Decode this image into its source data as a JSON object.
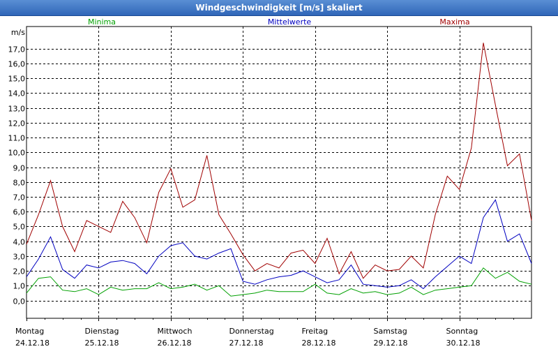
{
  "window": {
    "title": "Windgeschwindigkeit [m/s] skaliert"
  },
  "chart_data": {
    "type": "line",
    "title": "Windgeschwindigkeit [m/s] skaliert",
    "ylabel": "m/s",
    "ylim": [
      -1.2,
      18.5
    ],
    "yticks": [
      "0,0",
      "1,0",
      "2,0",
      "3,0",
      "4,0",
      "5,0",
      "6,0",
      "7,0",
      "8,0",
      "9,0",
      "10,0",
      "11,0",
      "12,0",
      "13,0",
      "14,0",
      "15,0",
      "16,0",
      "17,0"
    ],
    "grid": true,
    "legend_placement": "top",
    "days": [
      {
        "name": "Montag",
        "date": "24.12.18"
      },
      {
        "name": "Dienstag",
        "date": "25.12.18"
      },
      {
        "name": "Mittwoch",
        "date": "26.12.18"
      },
      {
        "name": "Donnerstag",
        "date": "27.12.18"
      },
      {
        "name": "Freitag",
        "date": "28.12.18"
      },
      {
        "name": "Samstag",
        "date": "29.12.18"
      },
      {
        "name": "Sonntag",
        "date": "30.12.18"
      }
    ],
    "x_unit": "hours since 24.12.18 00:00",
    "x": [
      0,
      4,
      8,
      12,
      16,
      20,
      24,
      28,
      32,
      36,
      40,
      44,
      48,
      52,
      56,
      60,
      64,
      68,
      72,
      76,
      80,
      84,
      88,
      92,
      96,
      100,
      104,
      108,
      112,
      116,
      120,
      124,
      128,
      132,
      136,
      140,
      144,
      148,
      152,
      156,
      160,
      164,
      168
    ],
    "series": [
      {
        "name": "Minima",
        "color": "#00a000",
        "values": [
          0.5,
          1.5,
          1.6,
          0.7,
          0.6,
          0.8,
          0.4,
          0.9,
          0.7,
          0.8,
          0.8,
          1.2,
          0.8,
          0.9,
          1.1,
          0.7,
          1.0,
          0.3,
          0.4,
          0.5,
          0.7,
          0.6,
          0.6,
          0.6,
          1.1,
          0.5,
          0.4,
          0.8,
          0.5,
          0.6,
          0.4,
          0.5,
          0.9,
          0.4,
          0.7,
          0.8,
          0.9,
          1.0,
          2.2,
          1.5,
          1.9,
          1.3,
          1.1
        ]
      },
      {
        "name": "Mittelwerte",
        "color": "#0000c0",
        "values": [
          1.6,
          2.8,
          4.3,
          2.1,
          1.5,
          2.4,
          2.2,
          2.6,
          2.7,
          2.5,
          1.8,
          3.0,
          3.7,
          3.9,
          3.0,
          2.8,
          3.2,
          3.5,
          1.3,
          1.1,
          1.4,
          1.6,
          1.7,
          2.0,
          1.6,
          1.2,
          1.4,
          2.4,
          1.1,
          1.0,
          0.9,
          1.0,
          1.4,
          0.8,
          1.6,
          2.3,
          3.0,
          2.5,
          5.6,
          6.8,
          4.0,
          4.5,
          2.5
        ]
      },
      {
        "name": "Maxima",
        "color": "#a00000",
        "values": [
          3.8,
          5.8,
          8.1,
          5.0,
          3.3,
          5.4,
          5.0,
          4.6,
          6.7,
          5.6,
          3.9,
          7.3,
          8.9,
          6.3,
          6.8,
          9.8,
          5.8,
          4.5,
          3.1,
          2.0,
          2.5,
          2.2,
          3.2,
          3.4,
          2.5,
          4.2,
          1.8,
          3.3,
          1.5,
          2.4,
          2.0,
          2.1,
          3.0,
          2.2,
          5.8,
          8.4,
          7.5,
          10.3,
          17.4,
          13.2,
          9.1,
          9.9,
          5.4
        ]
      }
    ]
  }
}
